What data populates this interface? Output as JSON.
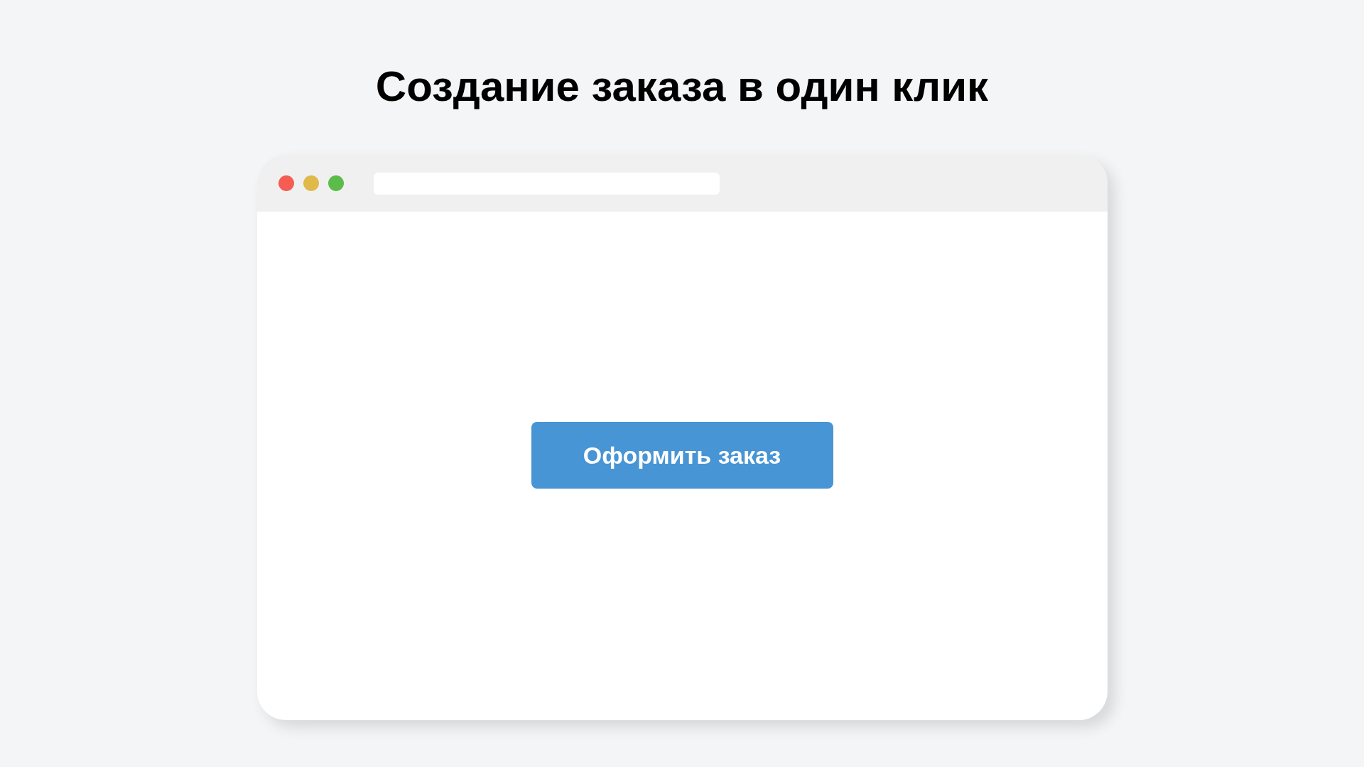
{
  "heading": "Создание заказа в один клик",
  "browser_window": {
    "button": {
      "label": "Оформить заказ"
    }
  }
}
